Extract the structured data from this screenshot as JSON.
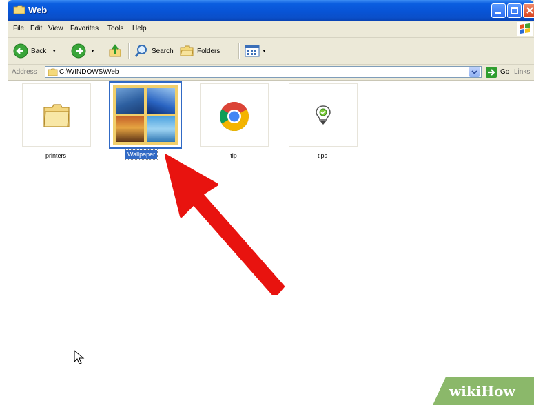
{
  "window": {
    "title": "Web",
    "colors": {
      "titlebar": "#0854d6",
      "selection": "#316ac5",
      "arrow": "#e8130f"
    }
  },
  "menubar": {
    "items": [
      "File",
      "Edit",
      "View",
      "Favorites",
      "Tools",
      "Help"
    ]
  },
  "toolbar": {
    "back_label": "Back",
    "search_label": "Search",
    "folders_label": "Folders"
  },
  "address": {
    "label": "Address",
    "value": "C:\\WINDOWS\\Web",
    "go_label": "Go",
    "links_label": "Links"
  },
  "folder_items": [
    {
      "name": "printers",
      "icon": "folder-icon"
    },
    {
      "name": "Wallpaper",
      "icon": "wallpaper-folder-icon",
      "selected": true
    },
    {
      "name": "tip",
      "icon": "chrome-icon"
    },
    {
      "name": "tips",
      "icon": "tips-icon"
    }
  ],
  "watermark": {
    "text": "wikiHow"
  }
}
